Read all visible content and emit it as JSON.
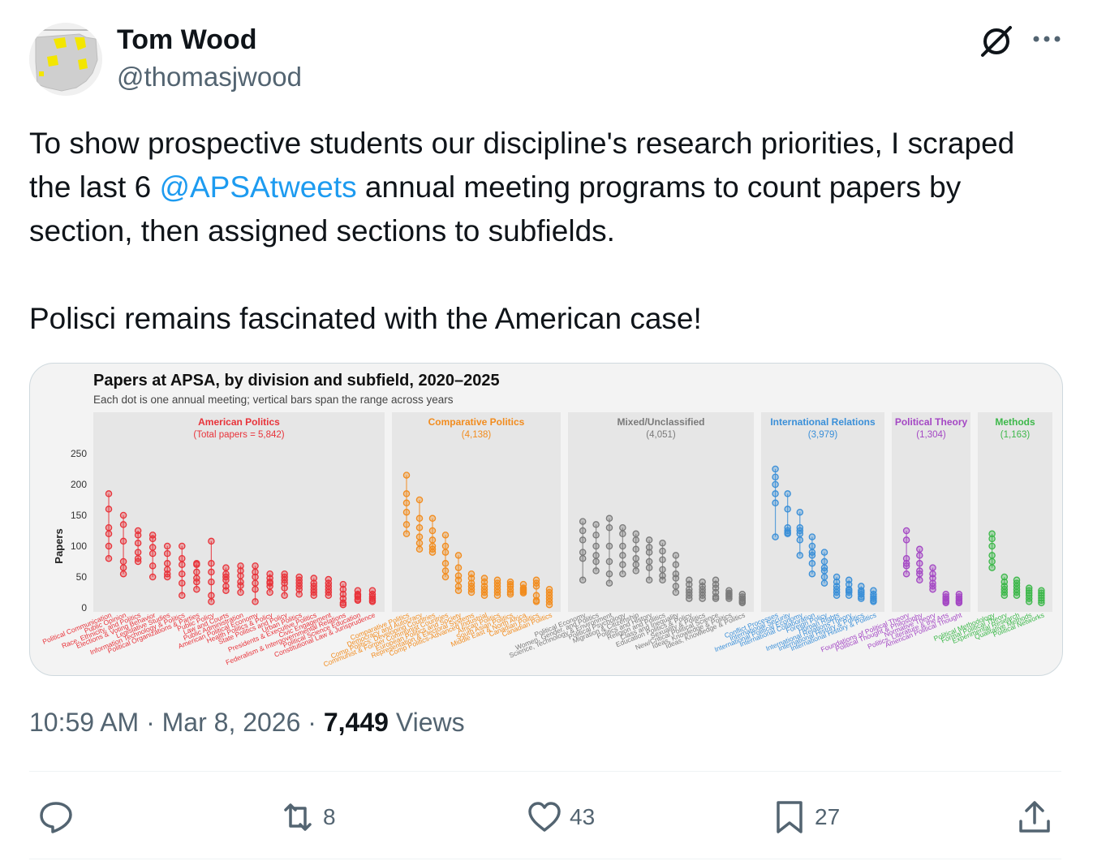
{
  "author": {
    "name": "Tom Wood",
    "handle": "@thomasjwood"
  },
  "tweet": {
    "line1_part1": "To show prospective students our discipline's research priorities, I scraped",
    "line2_part1": "the last 6 ",
    "mention": "@APSAtweets",
    "line2_part2": " annual meeting programs to count papers by",
    "line3": "section, then assigned sections to subfields.",
    "line4": "Polisci remains fascinated with the American case!"
  },
  "meta": {
    "time": "10:59 AM",
    "dot": "·",
    "date": "Mar 8, 2026",
    "views_count": "7,449",
    "views_label": "Views"
  },
  "actions": {
    "reply_count": "",
    "retweet_count": "8",
    "like_count": "43",
    "bookmark_count": "27"
  },
  "icons": [
    "reply-icon",
    "retweet-icon",
    "like-icon",
    "bookmark-icon",
    "share-icon",
    "grok-icon",
    "more-icon"
  ],
  "chart_data": {
    "type": "scatter",
    "title": "Papers at APSA, by division and subfield, 2020–2025",
    "subtitle": "Each dot is one annual meeting; vertical bars span the range across years",
    "ylabel": "Papers",
    "yticks": [
      0,
      50,
      100,
      150,
      200,
      250
    ],
    "ylim": [
      0,
      270
    ],
    "panels": [
      {
        "name": "American Politics",
        "total": "(Total papers = 5,842)",
        "color": "#e8333a",
        "bg": "#e6e6e6",
        "sections": [
          {
            "label": "Political Communication",
            "values": [
              185,
              160,
              130,
              120,
              100,
              80
            ]
          },
          {
            "label": "Public Opinion",
            "values": [
              150,
              135,
              108,
              75,
              65,
              55
            ]
          },
          {
            "label": "Race, Ethnicity, and Politics",
            "values": [
              125,
              118,
              105,
              90,
              80,
              75
            ]
          },
          {
            "label": "Elections & Voting Behavior",
            "values": [
              118,
              112,
              98,
              88,
              68,
              50
            ]
          },
          {
            "label": "Legislative Studies",
            "values": [
              100,
              88,
              72,
              62,
              55,
              50
            ]
          },
          {
            "label": "Information Technology & Politics",
            "values": [
              100,
              80,
              70,
              55,
              40,
              20
            ]
          },
          {
            "label": "Political Organizations & Parties",
            "values": [
              72,
              70,
              58,
              48,
              42,
              30
            ]
          },
          {
            "label": "Public Policy",
            "values": [
              108,
              72,
              58,
              42,
              20,
              10
            ]
          },
          {
            "label": "Law and Courts",
            "values": [
              65,
              55,
              50,
              45,
              35,
              28
            ]
          },
          {
            "label": "Public Administration",
            "values": [
              68,
              60,
              52,
              42,
              36,
              25
            ]
          },
          {
            "label": "American Political Economy",
            "values": [
              68,
              58,
              50,
              40,
              30,
              10
            ]
          },
          {
            "label": "Health Politics & Policy",
            "values": [
              55,
              48,
              42,
              40,
              35,
              25
            ]
          },
          {
            "label": "State Politics and Policy",
            "values": [
              55,
              50,
              45,
              40,
              32,
              20
            ]
          },
          {
            "label": "Urban Politics",
            "values": [
              50,
              45,
              40,
              35,
              30,
              22
            ]
          },
          {
            "label": "Presidents & Executive Politics",
            "values": [
              48,
              40,
              35,
              30,
              25,
              20
            ]
          },
          {
            "label": "Civic Engagement",
            "values": [
              46,
              40,
              35,
              30,
              25,
              20
            ]
          },
          {
            "label": "Federalism & Intergovernmental Relations",
            "values": [
              38,
              30,
              22,
              15,
              8,
              5
            ]
          },
          {
            "label": "Political Science Education",
            "values": [
              28,
              22,
              20,
              18,
              14,
              12
            ]
          },
          {
            "label": "Constitutional Law & Jurisprudence",
            "values": [
              28,
              22,
              18,
              15,
              12,
              10
            ]
          }
        ]
      },
      {
        "name": "Comparative Politics",
        "total": "(4,138)",
        "color": "#f28c1e",
        "bg": "#e6e6e6",
        "sections": [
          {
            "label": "Comparative Politics",
            "values": [
              215,
              185,
              170,
              155,
              135,
              120
            ]
          },
          {
            "label": "Democracy and Autocracy",
            "values": [
              175,
              145,
              130,
              115,
              105,
              95
            ]
          },
          {
            "label": "Comp Politics: Developing Countries",
            "values": [
              145,
              125,
              110,
              100,
              95,
              90
            ]
          },
          {
            "label": "Communist & Former Communist Countries",
            "values": [
              118,
              100,
              90,
              72,
              60,
              50
            ]
          },
          {
            "label": "European Politics and Society",
            "values": [
              85,
              65,
              52,
              45,
              35,
              28
            ]
          },
          {
            "label": "Representation & Electoral Systems",
            "values": [
              55,
              48,
              40,
              35,
              30,
              25
            ]
          },
          {
            "label": "Comp Politics-Advanced Industrial",
            "values": [
              48,
              42,
              35,
              30,
              25,
              20
            ]
          },
          {
            "label": "African Politics",
            "values": [
              45,
              40,
              35,
              30,
              25,
              20
            ]
          },
          {
            "label": "South Asian Politics",
            "values": [
              42,
              38,
              35,
              30,
              25,
              22
            ]
          },
          {
            "label": "Middle East & North Africa",
            "values": [
              38,
              32,
              30,
              28,
              26,
              24
            ]
          },
          {
            "label": "Canadian Politics",
            "values": [
              45,
              40,
              35,
              20,
              12,
              10
            ]
          },
          {
            "label": "Canadian Politics",
            "values": [
              30,
              25,
              20,
              15,
              10,
              5
            ]
          }
        ]
      },
      {
        "name": "Mixed/Unclassified",
        "total": "(4,051)",
        "color": "#7a7a7a",
        "bg": "#e6e6e6",
        "sections": [
          {
            "label": "Political Economy",
            "values": [
              140,
              125,
              110,
              90,
              80,
              45
            ]
          },
          {
            "label": "Women, Gender, and Politics",
            "values": [
              135,
              118,
              100,
              85,
              75,
              60
            ]
          },
          {
            "label": "Science, Technology & Environment",
            "values": [
              145,
              130,
              100,
              75,
              55,
              40
            ]
          },
          {
            "label": "Political Psychology",
            "values": [
              130,
              120,
              100,
              85,
              70,
              55
            ]
          },
          {
            "label": "Migration & Citizenship",
            "values": [
              120,
              110,
              95,
              80,
              70,
              60
            ]
          },
          {
            "label": "Politics and History",
            "values": [
              110,
              98,
              90,
              75,
              65,
              45
            ]
          },
          {
            "label": "Religion and Politics",
            "values": [
              105,
              92,
              78,
              62,
              52,
              45
            ]
          },
          {
            "label": "Class and Inequality",
            "values": [
              85,
              70,
              55,
              48,
              35,
              25
            ]
          },
          {
            "label": "Education Politics & Policy",
            "values": [
              45,
              38,
              30,
              25,
              20,
              15
            ]
          },
          {
            "label": "Sexuality & Politics",
            "values": [
              42,
              35,
              30,
              25,
              20,
              15
            ]
          },
          {
            "label": "New/Critical Political Science",
            "values": [
              45,
              38,
              32,
              25,
              18,
              15
            ]
          },
          {
            "label": "Ideas, Knowledge & Politics",
            "values": [
              28,
              24,
              22,
              20,
              18,
              15
            ]
          },
          {
            "label": "Ideas, Knowledge & Politics",
            "values": [
              22,
              18,
              15,
              12,
              10,
              8
            ]
          }
        ]
      },
      {
        "name": "International Relations",
        "total": "(3,979)",
        "color": "#3a8fd8",
        "bg": "#e6e6e6",
        "sections": [
          {
            "label": "Conflict Processes",
            "values": [
              225,
              212,
              200,
              185,
              170,
              115
            ]
          },
          {
            "label": "International Security",
            "values": [
              185,
              160,
              130,
              125,
              122,
              120
            ]
          },
          {
            "label": "International Political Economy",
            "values": [
              155,
              130,
              125,
              120,
              110,
              85
            ]
          },
          {
            "label": "International Collaboration",
            "values": [
              115,
              100,
              90,
              85,
              72,
              55
            ]
          },
          {
            "label": "Foreign Policy",
            "values": [
              90,
              75,
              65,
              60,
              50,
              40
            ]
          },
          {
            "label": "Human Rights",
            "values": [
              50,
              42,
              35,
              30,
              25,
              20
            ]
          },
          {
            "label": "International Relations Theory",
            "values": [
              45,
              38,
              30,
              28,
              25,
              20
            ]
          },
          {
            "label": "International History & Politics",
            "values": [
              35,
              28,
              25,
              22,
              18,
              15
            ]
          },
          {
            "label": "International History & Politics",
            "values": [
              28,
              22,
              18,
              15,
              12,
              10
            ]
          }
        ]
      },
      {
        "name": "Political Theory",
        "total": "(1,304)",
        "color": "#a447c4",
        "bg": "#e6e6e6",
        "sections": [
          {
            "label": "Foundations of Political Theory",
            "values": [
              125,
              110,
              80,
              72,
              68,
              55
            ]
          },
          {
            "label": "Political Thought & Philosophy",
            "values": [
              95,
              85,
              72,
              60,
              55,
              45
            ]
          },
          {
            "label": "Normative Theory",
            "values": [
              65,
              55,
              48,
              40,
              35,
              30
            ]
          },
          {
            "label": "Politics, Literature & the Arts",
            "values": [
              22,
              18,
              15,
              12,
              10,
              8
            ]
          },
          {
            "label": "American Political Thought",
            "values": [
              22,
              18,
              15,
              12,
              10,
              8
            ]
          }
        ]
      },
      {
        "name": "Methods",
        "total": "(1,163)",
        "color": "#3db84a",
        "bg": "#e6e6e6",
        "sections": [
          {
            "label": "Political Methodology",
            "values": [
              120,
              112,
              100,
              85,
              75,
              65
            ]
          },
          {
            "label": "Formal Political Theory",
            "values": [
              50,
              42,
              35,
              30,
              25,
              20
            ]
          },
          {
            "label": "Experimental Research",
            "values": [
              45,
              40,
              35,
              30,
              25,
              20
            ]
          },
          {
            "label": "Qualitative Methods",
            "values": [
              32,
              28,
              24,
              20,
              15,
              10
            ]
          },
          {
            "label": "Political Networks",
            "values": [
              28,
              24,
              20,
              16,
              12,
              8
            ]
          }
        ]
      }
    ]
  }
}
